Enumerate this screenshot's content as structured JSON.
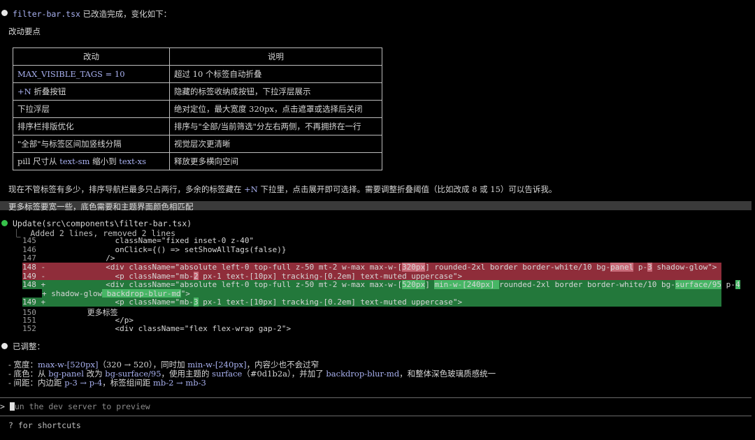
{
  "summary": {
    "file": "filter-bar.tsx",
    "text": " 已改造完成，变化如下：",
    "heading": "改动要点",
    "footer_pre": "现在不管标签有多少，排序导航栏最多只占两行，多余的标签藏在 ",
    "footer_code": "+N",
    "footer_post": " 下拉里，点击展开即可选择。需要调整折叠阈值（比如改成 8 或 15）可以告诉我。"
  },
  "table": {
    "headers": [
      "改动",
      "说明"
    ],
    "rows": [
      {
        "pre": "",
        "code": "MAX_VISIBLE_TAGS = 10",
        "post": "",
        "code2": "",
        "post2": "",
        "desc": "超过 10 个标签自动折叠"
      },
      {
        "pre": "",
        "code": "+N",
        "post": " 折叠按钮",
        "code2": "",
        "post2": "",
        "desc": "隐藏的标签收纳成按钮，下拉浮层展示"
      },
      {
        "pre": "下拉浮层",
        "code": "",
        "post": "",
        "code2": "",
        "post2": "",
        "desc": "绝对定位，最大宽度 320px，点击遮罩或选择后关闭"
      },
      {
        "pre": "排序栏排版优化",
        "code": "",
        "post": "",
        "code2": "",
        "post2": "",
        "desc": "排序与\"全部/当前筛选\"分左右两侧，不再拥挤在一行"
      },
      {
        "pre": "\"全部\"与标签区间加竖线分隔",
        "code": "",
        "post": "",
        "code2": "",
        "post2": "",
        "desc": "视觉层次更清晰"
      },
      {
        "pre": "pill 尺寸从 ",
        "code": "text-sm",
        "post": " 缩小到 ",
        "code2": "text-xs",
        "post2": "",
        "desc": "释放更多横向空间"
      }
    ]
  },
  "user_message": "更多标签要宽一些，底色需要和主题界面颜色相匹配",
  "update": {
    "title": "Update(src\\components\\filter-bar.tsx)",
    "subtitle": "⎿  Added 2 lines, removed 2 lines",
    "lines": {
      "l145": {
        "num": "145",
        "sign": " ",
        "text": "               className=\"fixed inset-0 z-40\""
      },
      "l146": {
        "num": "146",
        "sign": " ",
        "text": "               onClick={() => setShowAllTags(false)}"
      },
      "l147": {
        "num": "147",
        "sign": " ",
        "text": "             />"
      },
      "d148": {
        "num": "148",
        "sign": "-",
        "a": "             <div className=\"absolute left-0 top-full z-50 mt-2 w-max max-w-[",
        "b": "320px",
        "c": "] rounded-2xl border border-white/10 bg-",
        "d": "panel",
        "e": " p-",
        "f": "3",
        "g": " shadow-glow\">"
      },
      "d149": {
        "num": "149",
        "sign": "-",
        "a": "               <p className=\"mb-",
        "b": "2",
        "c": " px-1 text-[10px] tracking-[0.2em] text-muted uppercase\">"
      },
      "a148": {
        "num": "148",
        "sign": "+",
        "a": "             <div className=\"absolute left-0 top-full z-50 mt-2 w-max max-w-[",
        "b": "520px",
        "c": "] ",
        "d": "min-w-[240px] ",
        "e": "rounded-2xl border border-white/10 bg-",
        "f": "surface/95",
        "g": " p-",
        "h": "4"
      },
      "a148b": {
        "a": "+ shadow-glow",
        "b": " backdrop-blur-md",
        "c": "\">"
      },
      "a149": {
        "num": "149",
        "sign": "+",
        "a": "               <p className=\"mb-",
        "b": "3",
        "c": " px-1 text-[10px] tracking-[0.2em] text-muted uppercase\">"
      },
      "l150": {
        "num": "150",
        "sign": " ",
        "text": "                 更多标签"
      },
      "l151": {
        "num": "151",
        "sign": " ",
        "text": "               </p>"
      },
      "l152": {
        "num": "152",
        "sign": " ",
        "text": "               <div className=\"flex flex-wrap gap-2\">"
      }
    }
  },
  "adjusted": {
    "title": "已调整：",
    "items": [
      {
        "a": "- 宽度：",
        "b": "max-w-[520px]",
        "c": "（320 → 520），同时加 ",
        "d": "min-w-[240px]",
        "e": "，内容少也不会过窄",
        "f": "",
        "g": "",
        "h": "",
        "i": ""
      },
      {
        "a": "- 底色：从 ",
        "b": "bg-panel",
        "c": " 改为 ",
        "d": "bg-surface/95",
        "e": "，使用主题的 ",
        "f": "surface",
        "g": "（#0d1b2a），并加了 ",
        "h": "backdrop-blur-md",
        "i": "，和整体深色玻璃质感统一"
      },
      {
        "a": "- 间距：内边距 ",
        "b": "p-3 → p-4",
        "c": "，标签组间距 ",
        "d": "mb-2 → mb-3",
        "e": "",
        "f": "",
        "g": "",
        "h": "",
        "i": ""
      }
    ]
  },
  "input": {
    "prompt": ">",
    "placeholder": "Run the dev server to preview",
    "placeholder_rest": "un the dev server to preview",
    "hint": "? for shortcuts"
  }
}
